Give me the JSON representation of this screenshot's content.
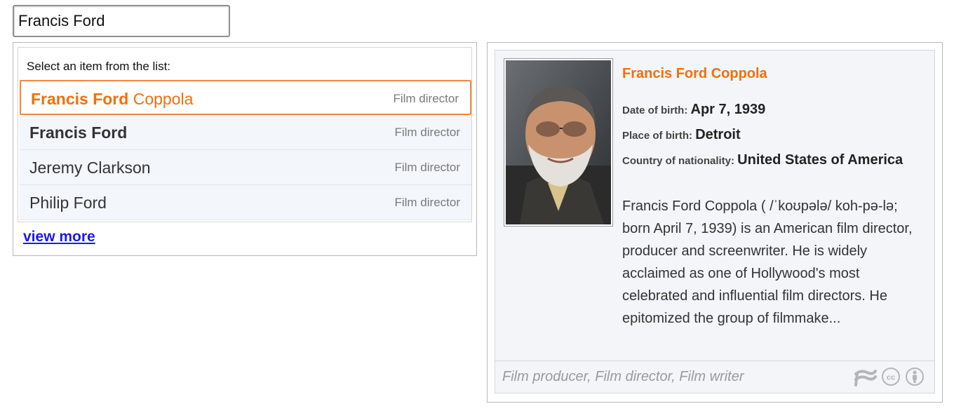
{
  "search": {
    "value": "Francis Ford"
  },
  "suggestions": {
    "prompt": "Select an item from the list:",
    "items": [
      {
        "match": "Francis Ford",
        "rest": " Coppola",
        "type": "Film director",
        "selected": true
      },
      {
        "match": "Francis Ford",
        "rest": "",
        "type": "Film director",
        "selected": false
      },
      {
        "match": "",
        "rest": "Jeremy Clarkson",
        "type": "Film director",
        "selected": false
      },
      {
        "match": "",
        "rest": "Philip Ford",
        "type": "Film director",
        "selected": false
      }
    ],
    "view_more": "view more"
  },
  "card": {
    "title": "Francis Ford Coppola",
    "date_of_birth_label": "Date of birth:",
    "date_of_birth": "Apr 7, 1939",
    "place_of_birth_label": "Place of birth:",
    "place_of_birth": "Detroit",
    "nationality_label": "Country of nationality:",
    "nationality": "United States of America",
    "description": "Francis Ford Coppola ( /ˈkoʊpələ/ koh-pə-lə; born April 7, 1939) is an American film director, producer and screenwriter. He is widely acclaimed as one of Hollywood's most celebrated and influential film directors. He epitomized the group of filmmake...",
    "footer_types": "Film producer, Film director, Film writer",
    "icons": [
      "freebase-icon",
      "creative-commons-icon",
      "attribution-icon"
    ]
  },
  "colors": {
    "accent": "#f26f0a",
    "selected_border": "#f5883b",
    "link": "#1a1ae8",
    "row_bg": "#f3f6fa"
  }
}
